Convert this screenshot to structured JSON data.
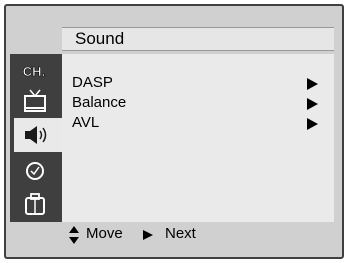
{
  "menu": {
    "title": "Sound",
    "items": [
      {
        "label": "DASP",
        "arrow": "right-arrow-icon"
      },
      {
        "label": "Balance",
        "arrow": "right-arrow-icon"
      },
      {
        "label": "AVL",
        "arrow": "right-arrow-icon"
      }
    ]
  },
  "sidebar": {
    "items": [
      {
        "icon": "channel-icon",
        "text": "CH."
      },
      {
        "icon": "tv-picture-icon"
      },
      {
        "icon": "speaker-sound-icon",
        "active": true
      },
      {
        "icon": "clock-icon"
      },
      {
        "icon": "toolbox-icon"
      }
    ]
  },
  "footer": {
    "move_label": "Move",
    "next_label": "Next"
  },
  "colors": {
    "frame": "#d0d0d0",
    "sidebar": "#3f3f3f",
    "panel": "#eaeaea",
    "active_tab": "#e9e9e9"
  }
}
